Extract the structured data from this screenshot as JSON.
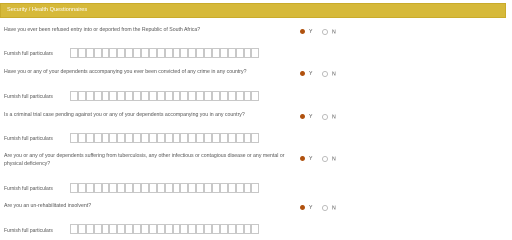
{
  "section_title": "Security / Health Questionnaires",
  "yes_label": "Y",
  "no_label": "N",
  "particulars_label": "Furnish full particulars",
  "questions": [
    {
      "text": "Have you ever been refused entry into or deported from the Republic of South Africa?",
      "answer": "Y"
    },
    {
      "text": "Have you or any of your dependents accompanying you ever been convicted of any crime in any country?",
      "answer": "Y"
    },
    {
      "text": "Is a criminal trial case pending against you or any of your dependents accompanying you in any country?",
      "answer": "Y"
    },
    {
      "text": "Are you or any of your dependents suffering from tuberculosis, any other infectious or contagious disease or any mental or physical deficiency?",
      "answer": "Y"
    },
    {
      "text": "Are you an un-rehabilitated insolvent?",
      "answer": "Y"
    }
  ]
}
